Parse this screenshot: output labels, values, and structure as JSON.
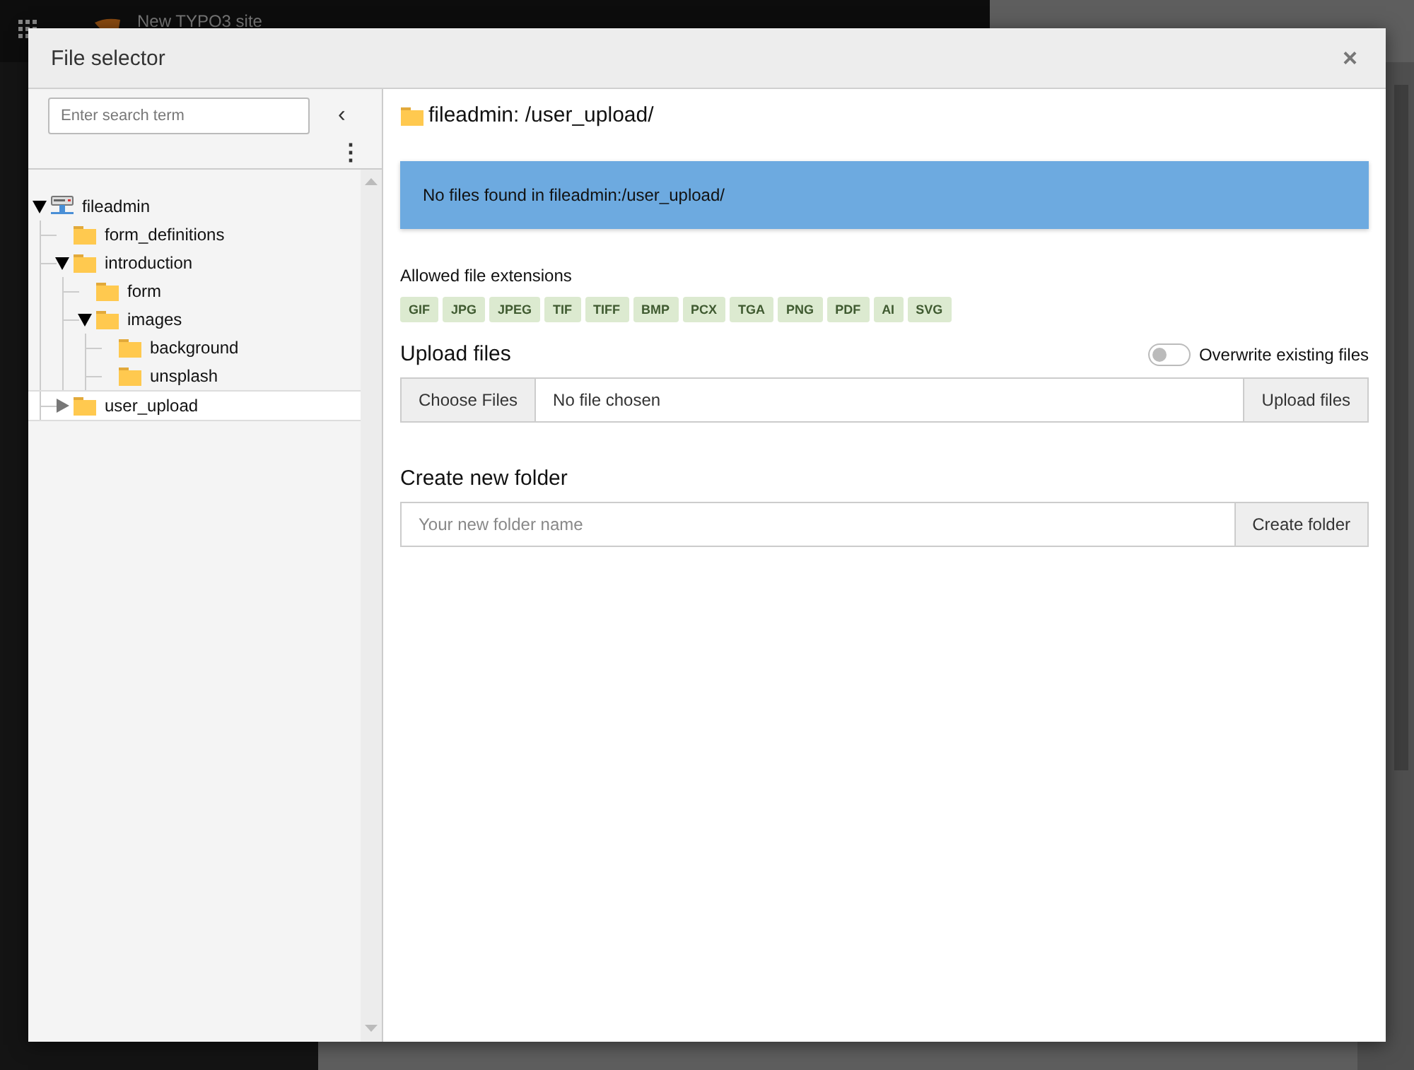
{
  "backdrop": {
    "site_name": "New TYPO3 site"
  },
  "modal": {
    "title": "File selector",
    "close": "×"
  },
  "tree_pane": {
    "search": {
      "placeholder": "Enter search term"
    },
    "collapse": "‹",
    "menu": "⋮",
    "tree": [
      {
        "label": "fileadmin",
        "kind": "storage",
        "expanded": true,
        "selected": false,
        "children": [
          {
            "label": "form_definitions",
            "kind": "folder",
            "selected": false
          },
          {
            "label": "introduction",
            "kind": "folder",
            "expanded": true,
            "selected": false,
            "children": [
              {
                "label": "form",
                "kind": "folder",
                "selected": false
              },
              {
                "label": "images",
                "kind": "folder",
                "expanded": true,
                "selected": false,
                "children": [
                  {
                    "label": "background",
                    "kind": "folder",
                    "selected": false
                  },
                  {
                    "label": "unsplash",
                    "kind": "folder",
                    "selected": false
                  }
                ]
              }
            ]
          },
          {
            "label": "user_upload",
            "kind": "folder",
            "expanded": false,
            "selected": true
          }
        ]
      }
    ]
  },
  "content": {
    "path_title": "fileadmin: /user_upload/",
    "info": "No files found in fileadmin:/user_upload/",
    "extensions_label": "Allowed file extensions",
    "extensions": [
      "GIF",
      "JPG",
      "JPEG",
      "TIF",
      "TIFF",
      "BMP",
      "PCX",
      "TGA",
      "PNG",
      "PDF",
      "AI",
      "SVG"
    ],
    "upload": {
      "heading": "Upload files",
      "overwrite": {
        "label": "Overwrite existing files",
        "on": false
      },
      "choose_button": "Choose Files",
      "file_status": "No file chosen",
      "submit": "Upload files"
    },
    "new_folder": {
      "heading": "Create new folder",
      "placeholder": "Your new folder name",
      "submit": "Create folder"
    }
  }
}
